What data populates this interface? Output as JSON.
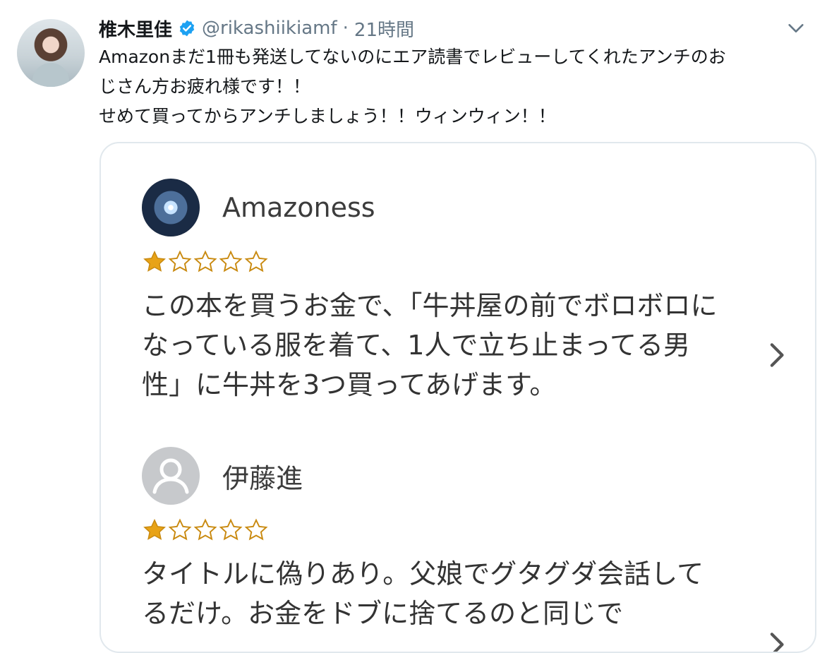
{
  "tweet": {
    "author_name": "椎木里佳",
    "handle": "@rikashiikiamf",
    "separator": "·",
    "time": "21時間",
    "text": "Amazonまだ1冊も発送してないのにエア読書でレビューしてくれたアンチのお\nじさん方お疲れ様です！！\nせめて買ってからアンチしましょう！！ウィンウィン！！",
    "verified": true
  },
  "card": {
    "reviews": [
      {
        "reviewer": "Amazoness",
        "avatar_icon": "space-avatar",
        "rating": 1,
        "max_rating": 5,
        "text": "この本を買うお金で、「牛丼屋の前でボロボロになっている服を着て、1人で立ち止まってる男性」に牛丼を3つ買ってあげます。"
      },
      {
        "reviewer": "伊藤進",
        "avatar_icon": "default-user-icon",
        "rating": 1,
        "max_rating": 5,
        "text": "タイトルに偽りあり。父娘でグタグダ会話してるだけ。お金をドブに捨てるのと同じで"
      }
    ]
  },
  "colors": {
    "verified_blue": "#1da1f2",
    "star_gold": "#e8a317",
    "muted": "#657786",
    "border": "#e1e8ed"
  }
}
